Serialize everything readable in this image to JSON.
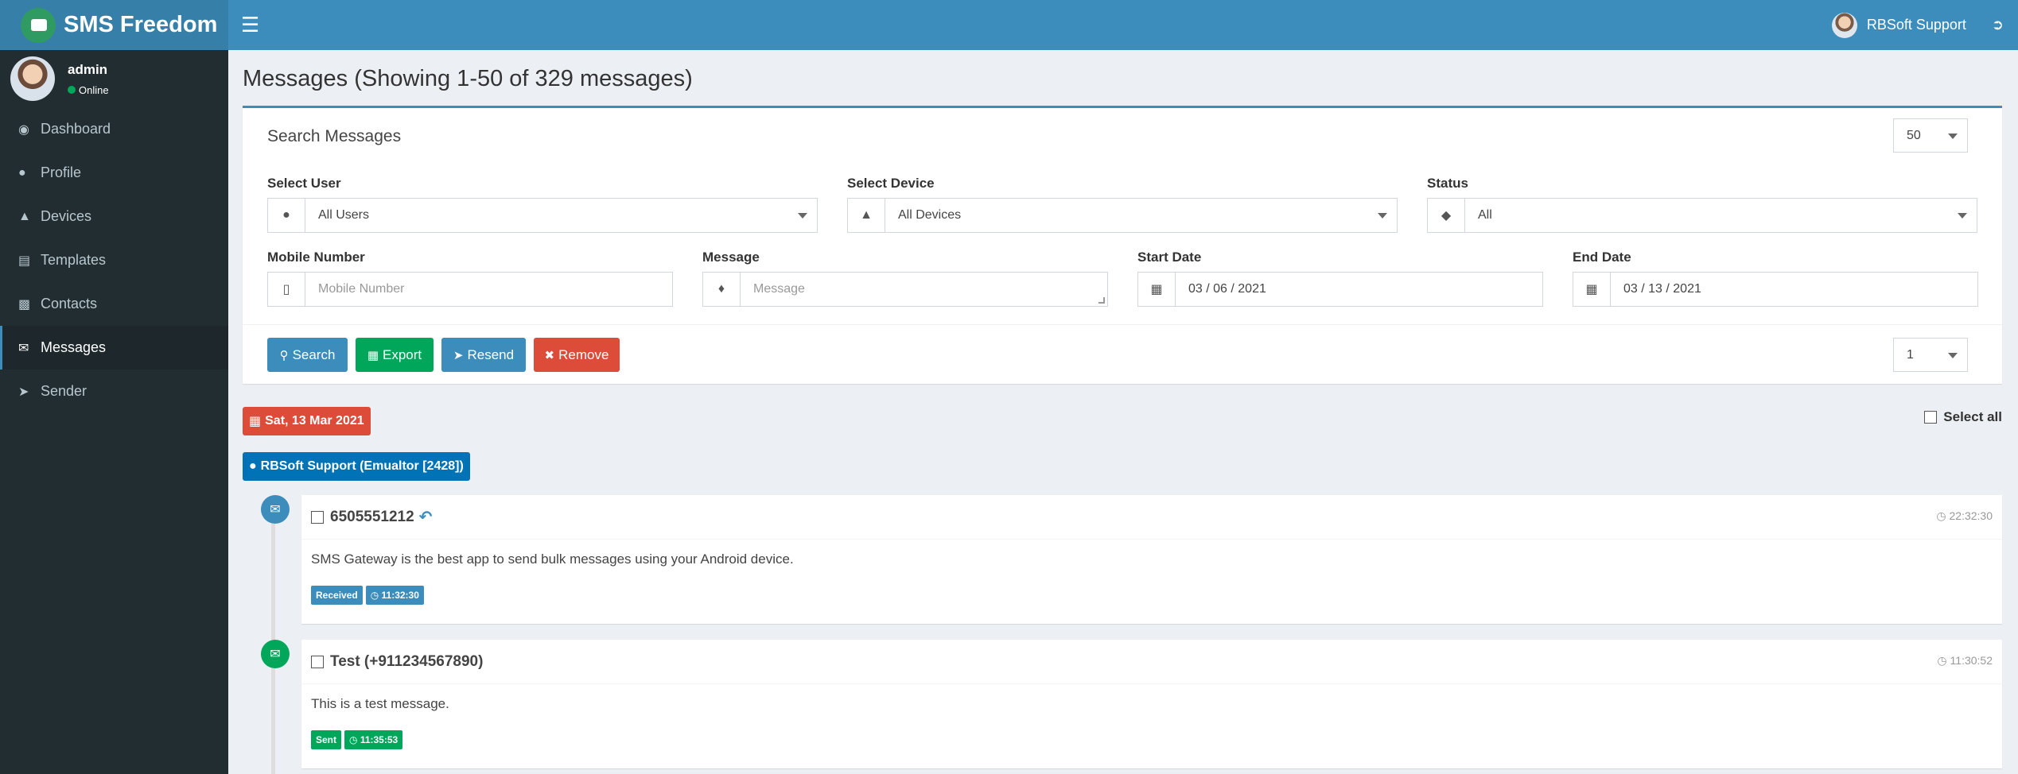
{
  "app": {
    "name": "SMS Freedom"
  },
  "topbar": {
    "user_name": "RBSoft Support"
  },
  "sidebar": {
    "user": {
      "name": "admin",
      "status": "Online"
    },
    "items": [
      {
        "label": "Dashboard",
        "icon": "dashboard-icon"
      },
      {
        "label": "Profile",
        "icon": "user-icon"
      },
      {
        "label": "Devices",
        "icon": "android-icon"
      },
      {
        "label": "Templates",
        "icon": "template-icon"
      },
      {
        "label": "Contacts",
        "icon": "address-card-icon"
      },
      {
        "label": "Messages",
        "icon": "envelope-icon",
        "active": true
      },
      {
        "label": "Sender",
        "icon": "paper-plane-icon"
      }
    ]
  },
  "page": {
    "title": "Messages (Showing 1-50 of 329 messages)"
  },
  "search": {
    "title": "Search Messages",
    "per_page": "50",
    "page_number": "1",
    "user_label": "Select User",
    "user_value": "All Users",
    "device_label": "Select Device",
    "device_value": "All Devices",
    "status_label": "Status",
    "status_value": "All",
    "mobile_label": "Mobile Number",
    "mobile_placeholder": "Mobile Number",
    "message_label": "Message",
    "message_placeholder": "Message",
    "start_label": "Start Date",
    "start_value": "03 / 06 / 2021",
    "end_label": "End Date",
    "end_value": "03 / 13 / 2021",
    "buttons": {
      "search": "Search",
      "export": "Export",
      "resend": "Resend",
      "remove": "Remove"
    }
  },
  "timeline": {
    "date": "Sat, 13 Mar 2021",
    "user": "RBSoft Support (Emualtor [2428])",
    "select_all": "Select all",
    "messages": [
      {
        "number": "6505551212",
        "time": "22:32:30",
        "body": "SMS Gateway is the best app to send bulk messages using your Android device.",
        "status": "Received",
        "status_time": "11:32:30",
        "color": "#3c8dbc"
      },
      {
        "number": "Test (+911234567890)",
        "time": "11:30:52",
        "body": "This is a test message.",
        "status": "Sent",
        "status_time": "11:35:53",
        "color": "#00a65a"
      }
    ]
  },
  "colors": {
    "primary": "#3c8dbc",
    "success": "#00a65a",
    "danger": "#dd4b39",
    "sidebar": "#222d32"
  }
}
